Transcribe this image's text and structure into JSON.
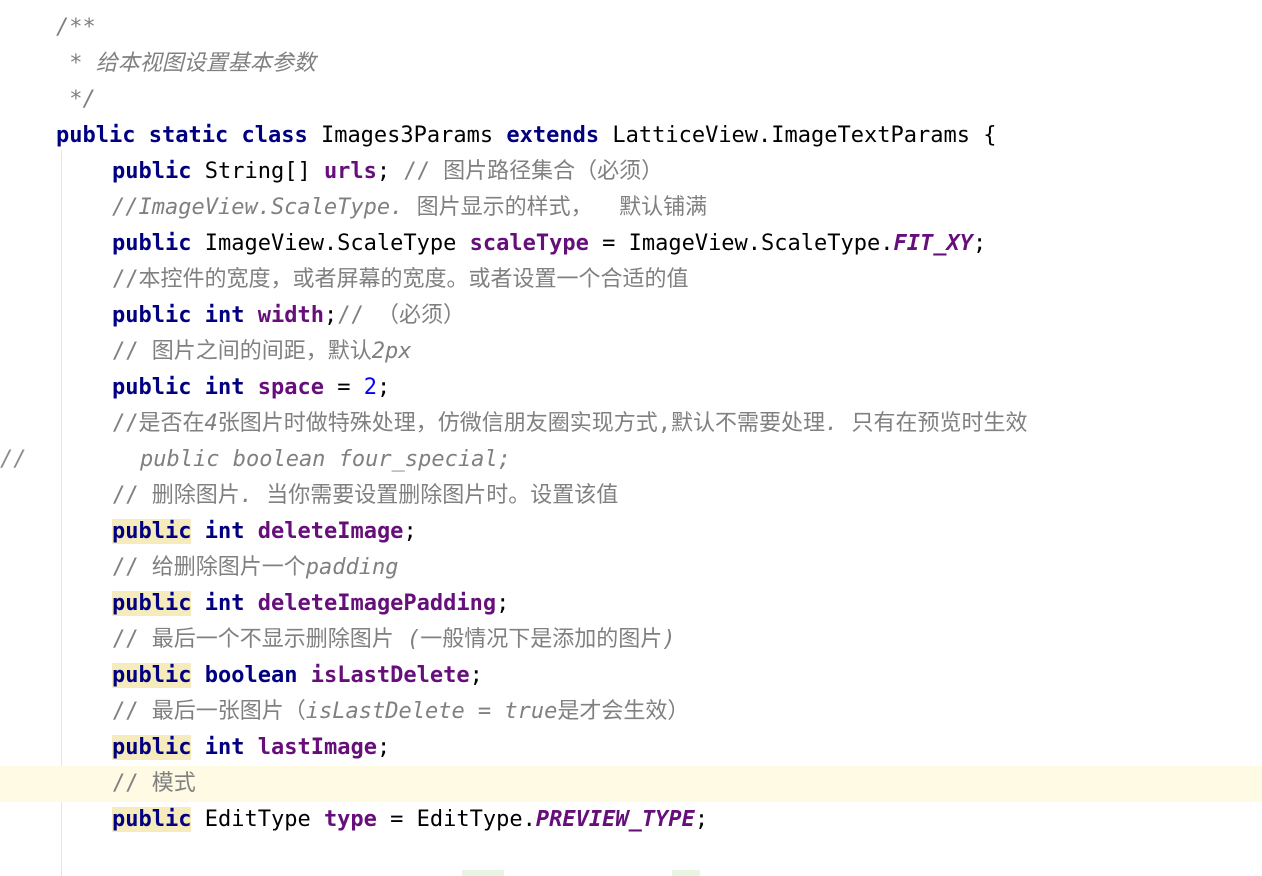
{
  "editor": {
    "lines": [
      {
        "indent": 56,
        "tokens": [
          {
            "t": "/**",
            "c": "doc"
          }
        ]
      },
      {
        "indent": 56,
        "tokens": [
          {
            "t": " * 给本视图设置基本参数",
            "c": "doc"
          }
        ]
      },
      {
        "indent": 56,
        "tokens": [
          {
            "t": " */",
            "c": "doc"
          }
        ]
      },
      {
        "indent": 56,
        "tokens": [
          {
            "t": "public",
            "c": "kw"
          },
          {
            "t": " ",
            "c": "plain"
          },
          {
            "t": "static",
            "c": "kw"
          },
          {
            "t": " ",
            "c": "plain"
          },
          {
            "t": "class",
            "c": "kw"
          },
          {
            "t": " Images3Params ",
            "c": "plain"
          },
          {
            "t": "extends",
            "c": "kw"
          },
          {
            "t": " LatticeView.ImageTextParams {",
            "c": "plain"
          }
        ]
      },
      {
        "indent": 112,
        "tokens": [
          {
            "t": "public",
            "c": "kw"
          },
          {
            "t": " String[] ",
            "c": "plain"
          },
          {
            "t": "urls",
            "c": "fld"
          },
          {
            "t": ";",
            "c": "plain"
          },
          {
            "t": " // 图片路径集合（必须）",
            "c": "cmt"
          }
        ]
      },
      {
        "indent": 112,
        "tokens": [
          {
            "t": "//ImageView.ScaleType.",
            "c": "cmt-i"
          },
          {
            "t": " 图片显示的样式，  默认铺满",
            "c": "cmt"
          }
        ]
      },
      {
        "indent": 112,
        "tokens": [
          {
            "t": "public",
            "c": "kw"
          },
          {
            "t": " ImageView.ScaleType ",
            "c": "plain"
          },
          {
            "t": "scaleType",
            "c": "fld"
          },
          {
            "t": " = ImageView.ScaleType.",
            "c": "plain"
          },
          {
            "t": "FIT_XY",
            "c": "sfld"
          },
          {
            "t": ";",
            "c": "plain"
          }
        ]
      },
      {
        "indent": 112,
        "tokens": [
          {
            "t": "//本控件的宽度，或者屏幕的宽度。或者设置一个合适的值",
            "c": "cmt"
          }
        ]
      },
      {
        "indent": 112,
        "tokens": [
          {
            "t": "public",
            "c": "kw"
          },
          {
            "t": " ",
            "c": "plain"
          },
          {
            "t": "int",
            "c": "kw"
          },
          {
            "t": " ",
            "c": "plain"
          },
          {
            "t": "width",
            "c": "fld"
          },
          {
            "t": ";",
            "c": "plain"
          },
          {
            "t": "// （必须）",
            "c": "cmt"
          }
        ]
      },
      {
        "indent": 112,
        "tokens": [
          {
            "t": "// 图片之间的间距，默认",
            "c": "cmt"
          },
          {
            "t": "2px",
            "c": "cmt-i"
          }
        ]
      },
      {
        "indent": 112,
        "tokens": [
          {
            "t": "public",
            "c": "kw"
          },
          {
            "t": " ",
            "c": "plain"
          },
          {
            "t": "int",
            "c": "kw"
          },
          {
            "t": " ",
            "c": "plain"
          },
          {
            "t": "space",
            "c": "fld"
          },
          {
            "t": " = ",
            "c": "plain"
          },
          {
            "t": "2",
            "c": "num"
          },
          {
            "t": ";",
            "c": "plain"
          }
        ]
      },
      {
        "indent": 112,
        "tokens": [
          {
            "t": "//是否在",
            "c": "cmt"
          },
          {
            "t": "4",
            "c": "cmt-i"
          },
          {
            "t": "张图片时做特殊处理，仿微信朋友圈实现方式,默认不需要处理",
            "c": "cmt"
          },
          {
            "t": ".",
            "c": "cmt-i"
          },
          {
            "t": " 只有在预览时生效",
            "c": "cmt"
          }
        ]
      },
      {
        "indent": 140,
        "gutter": "//",
        "tokens": [
          {
            "t": "public boolean four_special;",
            "c": "cmt-i"
          }
        ]
      },
      {
        "indent": 112,
        "tokens": [
          {
            "t": "// 删除图片",
            "c": "cmt"
          },
          {
            "t": ".",
            "c": "cmt-i"
          },
          {
            "t": " 当你需要设置删除图片时。设置该值",
            "c": "cmt"
          }
        ]
      },
      {
        "indent": 112,
        "tokens": [
          {
            "t": "public",
            "c": "kw hl"
          },
          {
            "t": " ",
            "c": "plain"
          },
          {
            "t": "int",
            "c": "kw"
          },
          {
            "t": " ",
            "c": "plain"
          },
          {
            "t": "deleteImage",
            "c": "fld"
          },
          {
            "t": ";",
            "c": "plain"
          }
        ]
      },
      {
        "indent": 112,
        "tokens": [
          {
            "t": "// 给删除图片一个",
            "c": "cmt"
          },
          {
            "t": "padding",
            "c": "cmt-i"
          }
        ]
      },
      {
        "indent": 112,
        "tokens": [
          {
            "t": "public",
            "c": "kw hl"
          },
          {
            "t": " ",
            "c": "plain"
          },
          {
            "t": "int",
            "c": "kw"
          },
          {
            "t": " ",
            "c": "plain"
          },
          {
            "t": "deleteImagePadding",
            "c": "fld"
          },
          {
            "t": ";",
            "c": "plain"
          }
        ]
      },
      {
        "indent": 112,
        "tokens": [
          {
            "t": "// 最后一个不显示删除图片 ",
            "c": "cmt"
          },
          {
            "t": "(",
            "c": "cmt-i"
          },
          {
            "t": "一般情况下是添加的图片",
            "c": "cmt"
          },
          {
            "t": ")",
            "c": "cmt-i"
          }
        ]
      },
      {
        "indent": 112,
        "tokens": [
          {
            "t": "public",
            "c": "kw hl"
          },
          {
            "t": " ",
            "c": "plain"
          },
          {
            "t": "boolean",
            "c": "kw"
          },
          {
            "t": " ",
            "c": "plain"
          },
          {
            "t": "isLastDelete",
            "c": "fld"
          },
          {
            "t": ";",
            "c": "plain"
          }
        ]
      },
      {
        "indent": 112,
        "tokens": [
          {
            "t": "// 最后一张图片（",
            "c": "cmt"
          },
          {
            "t": "isLastDelete = true",
            "c": "cmt-i"
          },
          {
            "t": "是才会生效）",
            "c": "cmt"
          }
        ]
      },
      {
        "indent": 112,
        "tokens": [
          {
            "t": "public",
            "c": "kw hl"
          },
          {
            "t": " ",
            "c": "plain"
          },
          {
            "t": "int",
            "c": "kw"
          },
          {
            "t": " ",
            "c": "plain"
          },
          {
            "t": "lastImage",
            "c": "fld"
          },
          {
            "t": ";",
            "c": "plain"
          }
        ]
      },
      {
        "indent": 112,
        "current": true,
        "tokens": [
          {
            "t": "// 模式",
            "c": "cmt"
          }
        ]
      },
      {
        "indent": 112,
        "tokens": [
          {
            "t": "public",
            "c": "kw hl"
          },
          {
            "t": " EditType ",
            "c": "plain"
          },
          {
            "t": "type",
            "c": "fld"
          },
          {
            "t": " = EditType.",
            "c": "plain"
          },
          {
            "t": "PREVIEW_TYPE",
            "c": "sfld"
          },
          {
            "t": ";",
            "c": "plain"
          }
        ]
      }
    ]
  },
  "colors": {
    "background": "#ffffff",
    "keyword": "#000080",
    "field": "#660e7a",
    "number": "#0000ff",
    "comment": "#808080",
    "current_line": "#fffae3",
    "usage_highlight": "#f6ebbc"
  }
}
